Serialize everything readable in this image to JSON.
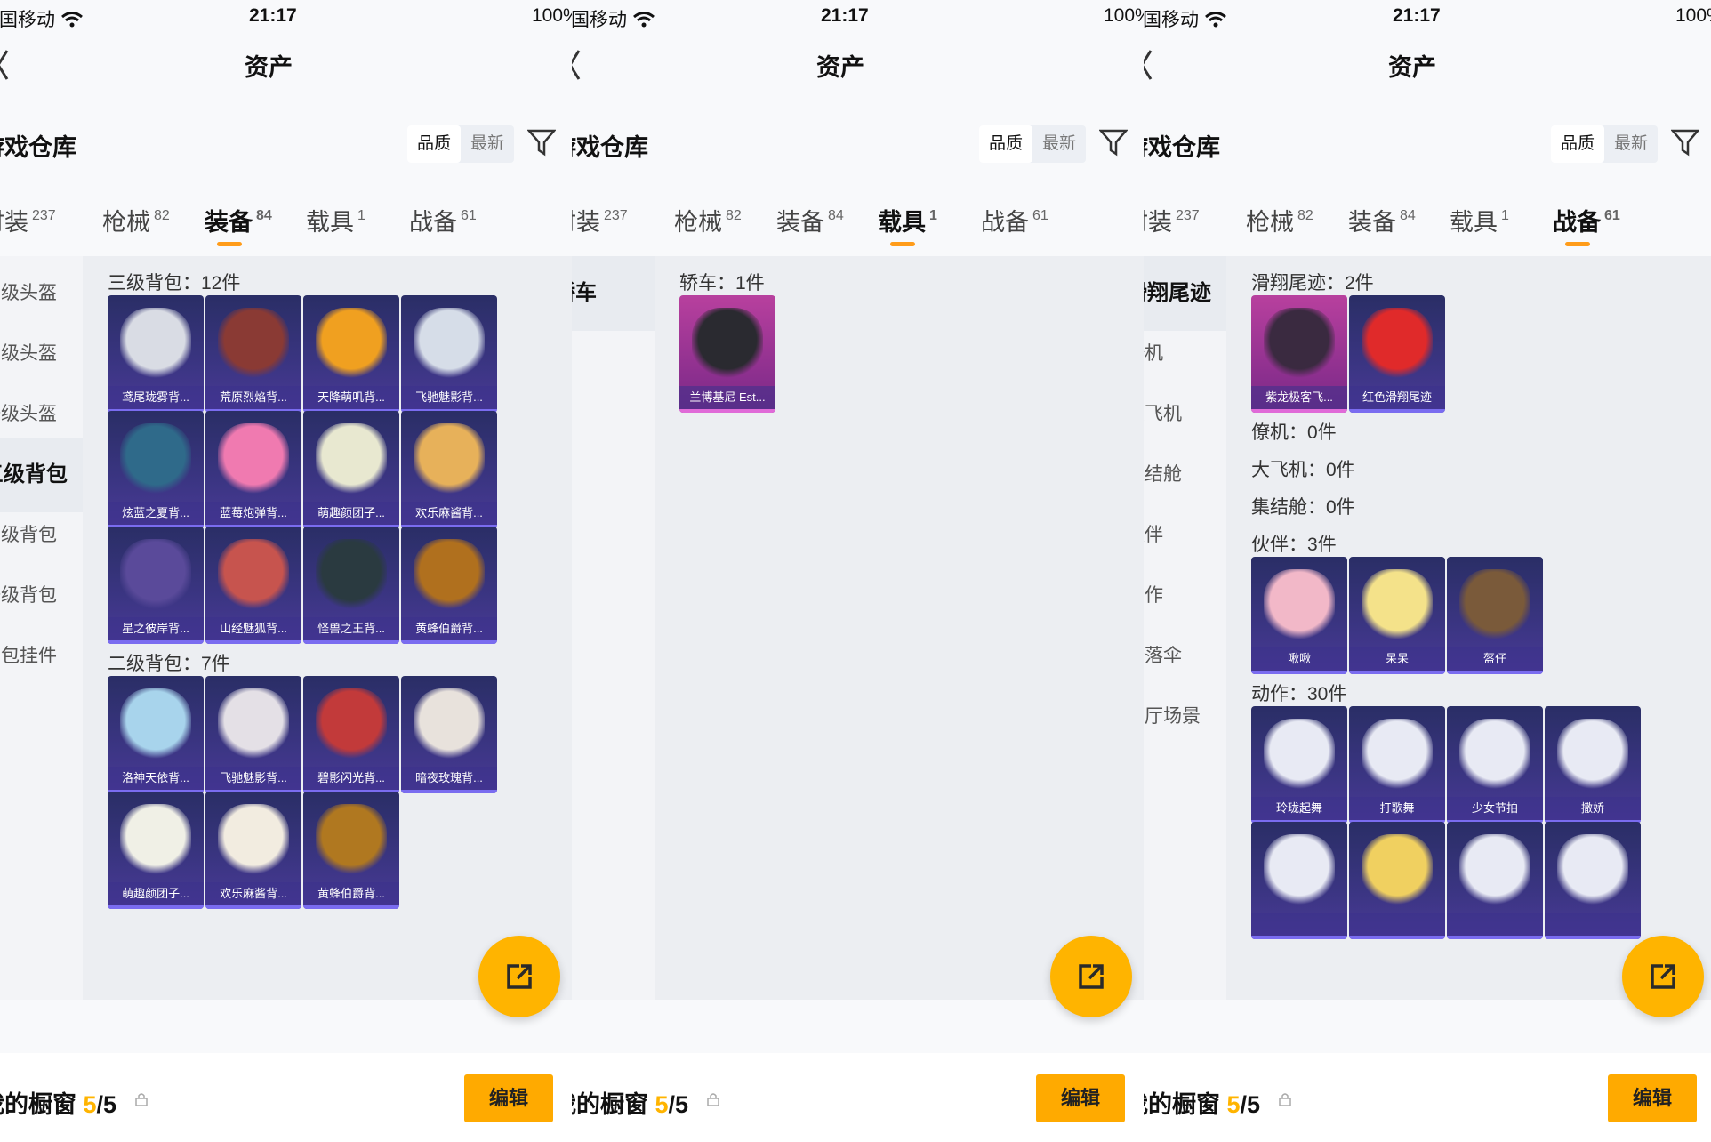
{
  "status_bar": {
    "carrier": "中国移动",
    "time": "21:17",
    "battery": "100%"
  },
  "header": {
    "title": "资产"
  },
  "section": {
    "title": "游戏仓库"
  },
  "sort": {
    "quality_label": "品质",
    "latest_label": "最新"
  },
  "tabs": [
    {
      "label": "时装",
      "count": "237"
    },
    {
      "label": "枪械",
      "count": "82"
    },
    {
      "label": "装备",
      "count": "84"
    },
    {
      "label": "载具",
      "count": "1"
    },
    {
      "label": "战备",
      "count": "61"
    }
  ],
  "screen1": {
    "active_tab": 2,
    "side_items": [
      "三级头盔",
      "二级头盔",
      "一级头盔",
      "三级背包",
      "二级背包",
      "一级背包",
      "背包挂件"
    ],
    "active_side_index": 3,
    "groups": [
      {
        "label": "三级背包：12件",
        "items": [
          {
            "name": "鸢尾珑雾背...",
            "color": "#d9dce4"
          },
          {
            "name": "荒原烈焰背...",
            "color": "#8a3a34"
          },
          {
            "name": "天降萌叽背...",
            "color": "#f0a020"
          },
          {
            "name": "飞驰魅影背...",
            "color": "#d6dde8"
          },
          {
            "name": "炫蓝之夏背...",
            "color": "#2f6a8a"
          },
          {
            "name": "蓝莓炮弹背...",
            "color": "#f07ab0"
          },
          {
            "name": "萌趣颜团子...",
            "color": "#e8e8d0"
          },
          {
            "name": "欢乐麻酱背...",
            "color": "#e7b15a"
          },
          {
            "name": "星之彼岸背...",
            "color": "#5a4a9a"
          },
          {
            "name": "山经魅狐背...",
            "color": "#c7544e"
          },
          {
            "name": "怪兽之王背...",
            "color": "#2a3a40"
          },
          {
            "name": "黄蜂伯爵背...",
            "color": "#b0701e"
          }
        ]
      },
      {
        "label": "二级背包：7件",
        "items": [
          {
            "name": "洛神天依背...",
            "color": "#a8d4ec"
          },
          {
            "name": "飞驰魅影背...",
            "color": "#e4e0e6"
          },
          {
            "name": "碧影闪光背...",
            "color": "#c23a3a"
          },
          {
            "name": "暗夜玫瑰背...",
            "color": "#e8e2dc"
          },
          {
            "name": "萌趣颜团子...",
            "color": "#f0f0e6"
          },
          {
            "name": "欢乐麻酱背...",
            "color": "#f2ece0"
          },
          {
            "name": "黄蜂伯爵背...",
            "color": "#b07820"
          }
        ]
      }
    ]
  },
  "screen2": {
    "active_tab": 3,
    "side_items": [
      "轿车"
    ],
    "active_side_index": 0,
    "groups": [
      {
        "label": "轿车：1件",
        "items": [
          {
            "name": "兰博基尼 Est...",
            "color": "#2a2a30",
            "rarity": "purple"
          }
        ]
      }
    ]
  },
  "screen3": {
    "active_tab": 4,
    "side_items": [
      "滑翔尾迹",
      "僚机",
      "大飞机",
      "集结舱",
      "伙伴",
      "动作",
      "降落伞",
      "大厅场景"
    ],
    "active_side_index": 0,
    "groups": [
      {
        "label": "滑翔尾迹：2件",
        "items": [
          {
            "name": "紫龙极客飞...",
            "color": "#3a2a40",
            "rarity": "purple"
          },
          {
            "name": "红色滑翔尾迹",
            "color": "#e02a2a"
          }
        ]
      },
      {
        "label": "僚机：0件",
        "items": []
      },
      {
        "label": "大飞机：0件",
        "items": []
      },
      {
        "label": "集结舱：0件",
        "items": []
      },
      {
        "label": "伙伴：3件",
        "items": [
          {
            "name": "啾啾",
            "color": "#f2b8c8"
          },
          {
            "name": "呆呆",
            "color": "#f4e28a"
          },
          {
            "name": "盔仔",
            "color": "#7a5a3a"
          }
        ]
      },
      {
        "label": "动作：30件",
        "items": [
          {
            "name": "玲珑起舞",
            "color": "#e8eaf4"
          },
          {
            "name": "打歌舞",
            "color": "#e8eaf4"
          },
          {
            "name": "少女节拍",
            "color": "#e8eaf4"
          },
          {
            "name": "撒娇",
            "color": "#e8eaf4"
          },
          {
            "name": "",
            "color": "#e8eaf4"
          },
          {
            "name": "",
            "color": "#f0d060"
          },
          {
            "name": "",
            "color": "#e8eaf4"
          },
          {
            "name": "",
            "color": "#e8eaf4"
          }
        ]
      }
    ]
  },
  "footer": {
    "showcase_label": "我的橱窗",
    "showcase_count": "5",
    "showcase_total": "/5",
    "edit_label": "编辑"
  }
}
